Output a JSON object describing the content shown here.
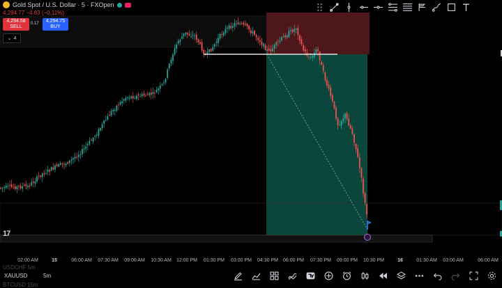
{
  "header": {
    "symbol_title": "Gold Spot / U.S. Dollar · 5 · FXOpen",
    "ohlc": "4,294.77  −4.83 (−0.11%)"
  },
  "trade": {
    "sell_price": "4,294.58",
    "sell_label": "SELL",
    "spread": "0.17",
    "buy_price": "4,294.75",
    "buy_label": "BUY"
  },
  "indicators_toggle": {
    "count": "4"
  },
  "drawing_toolbar": {
    "tools": [
      "drag-handle-icon",
      "trend-line-icon",
      "vertical-line-icon",
      "horizontal-ray-icon",
      "horizontal-line-icon",
      "parallel-channel-icon",
      "fib-retracement-icon",
      "pitchfork-icon",
      "brush-icon",
      "rectangle-icon",
      "text-icon"
    ]
  },
  "time_axis": {
    "labels": [
      "02:00 AM",
      "15",
      "06:00 AM",
      "07:30 AM",
      "09:00 AM",
      "10:30 AM",
      "12:00 PM",
      "01:30 PM",
      "03:00 PM",
      "04:30 PM",
      "06:00 PM",
      "07:30 PM",
      "09:00 PM",
      "10:30 PM",
      "16",
      "01:30 AM",
      "03:00 AM",
      "06:00 AM"
    ]
  },
  "bottom_bar": {
    "ghost_top": "USDCHF   5m",
    "symbol": "XAUUSD",
    "timeframe": "5m",
    "ghost_bottom": "BTCUSD   15m",
    "icons": [
      "pencil-icon",
      "chart-type-icon",
      "layout-grid-icon",
      "indicators-icon",
      "tv-logo-icon",
      "add-icon",
      "alarm-icon",
      "candles-icon",
      "replay-icon",
      "layers-icon",
      "more-icon",
      "undo-icon",
      "redo-icon",
      "fullscreen-icon",
      "settings-icon"
    ]
  },
  "colors": {
    "up": "#26a69a",
    "down": "#ef5350",
    "stop_zone": "#5a1f24",
    "target_zone": "#0b4a3e",
    "accent": "#2962ff"
  }
}
